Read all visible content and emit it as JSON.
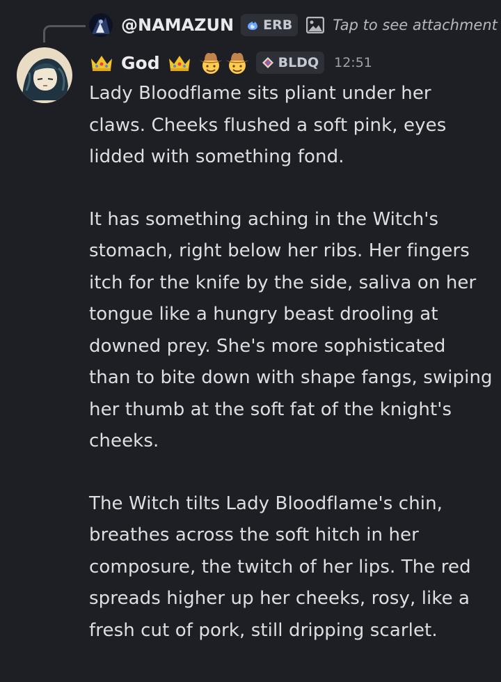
{
  "reply": {
    "username": "@NAMAZUN",
    "tag_label": "ERB",
    "attachment_text": "Tap to see attachment"
  },
  "author": {
    "display_name": "God",
    "tag_label": "BLDQ",
    "timestamp": "12:51",
    "decorations": [
      "crown-emoji",
      "crown-emoji",
      "cowboy-hat-face-emoji",
      "cowboy-hat-face-emoji"
    ]
  },
  "message": {
    "paragraphs": [
      "Lady Bloodflame sits pliant under her claws. Cheeks flushed a soft pink, eyes lidded with something fond.",
      "It has something aching in the Witch's stomach, right below her ribs. Her fingers itch for the knife by the side, saliva on her tongue like a hungry beast drooling at downed prey. She's more sophisticated than to bite down with shape fangs, swiping her thumb at the soft fat of the knight's cheeks.",
      "The Witch tilts Lady Bloodflame's chin, breathes across the soft hitch in her composure, the twitch of her lips. The red spreads higher up her cheeks, rosy, like a fresh cut of pork, still dripping scarlet."
    ]
  },
  "colors": {
    "background": "#1e1f24",
    "text": "#dedfe3",
    "tag_background": "#2e3037",
    "reply_line": "#55575f",
    "crown": "#f4c22b",
    "cowboy_hat": "#a0672f",
    "face": "#ffcc4d"
  }
}
